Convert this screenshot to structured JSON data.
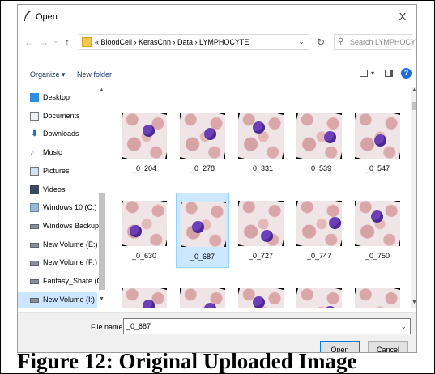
{
  "window": {
    "title": "Open",
    "close_glyph": "X",
    "icon": "feather-pen-icon"
  },
  "navigation": {
    "back_glyph": "←",
    "forward_glyph": "→",
    "recent_glyph": "⌄",
    "up_glyph": "↑",
    "address_path": "« BloodCell › KerasCnn › Data › LYMPHOCYTE",
    "address_dropdown_glyph": "⌄",
    "refresh_glyph": "↻",
    "search_placeholder": "Search LYMPHOCYTE",
    "search_glyph": "⚲"
  },
  "toolbar": {
    "organize_label": "Organize ▾",
    "new_folder_label": "New folder",
    "view_dropdown_glyph": "▾",
    "help_glyph": "?"
  },
  "sidebar": {
    "scroll_up_glyph": "▲",
    "scroll_down_glyph": "▼",
    "items": [
      {
        "label": "Desktop",
        "icon": "desktop-icon"
      },
      {
        "label": "Documents",
        "icon": "documents-icon"
      },
      {
        "label": "Downloads",
        "icon": "downloads-icon",
        "glyph": "⬇"
      },
      {
        "label": "Music",
        "icon": "music-icon",
        "glyph": "♪"
      },
      {
        "label": "Pictures",
        "icon": "pictures-icon"
      },
      {
        "label": "Videos",
        "icon": "videos-icon"
      },
      {
        "label": "Windows 10 (C:)",
        "icon": "windows-drive-icon"
      },
      {
        "label": "Windows Backup",
        "icon": "drive-icon"
      },
      {
        "label": "New Volume (E:)",
        "icon": "drive-icon"
      },
      {
        "label": "New Volume (F:)",
        "icon": "drive-icon"
      },
      {
        "label": "Fantasy_Share (G",
        "icon": "drive-icon"
      },
      {
        "label": "New Volume (I:)",
        "icon": "drive-icon",
        "selected": true
      }
    ]
  },
  "files": {
    "items": [
      {
        "label": "_0_204",
        "selected": false
      },
      {
        "label": "_0_278",
        "selected": false
      },
      {
        "label": "_0_331",
        "selected": false
      },
      {
        "label": "_0_539",
        "selected": false
      },
      {
        "label": "_0_547",
        "selected": false
      },
      {
        "label": "_0_630",
        "selected": false
      },
      {
        "label": "_0_687",
        "selected": true
      },
      {
        "label": "_0_727",
        "selected": false
      },
      {
        "label": "_0_747",
        "selected": false
      },
      {
        "label": "_0_750",
        "selected": false
      }
    ],
    "scroll_up_glyph": "▲",
    "scroll_down_glyph": "▼"
  },
  "footer": {
    "file_name_label": "File name:",
    "file_name_value": "_0_687",
    "file_name_dropdown_glyph": "⌄",
    "open_label": "Open",
    "cancel_label": "Cancel"
  },
  "caption": "Figure 12: Original Uploaded Image"
}
